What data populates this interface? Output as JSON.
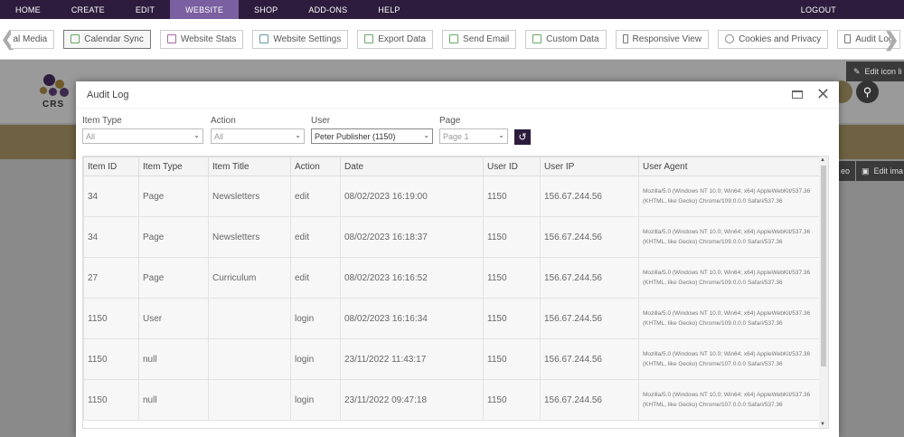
{
  "topnav": {
    "items": [
      "HOME",
      "CREATE",
      "EDIT",
      "WEBSITE",
      "SHOP",
      "ADD-ONS",
      "HELP"
    ],
    "active_index": 3,
    "logout": "LOGOUT"
  },
  "toolbar": {
    "buttons": [
      "al Media",
      "Calendar Sync",
      "Website Stats",
      "Website Settings",
      "Export Data",
      "Send Email",
      "Custom Data",
      "Responsive View",
      "Cookies and Privacy",
      "Audit Log"
    ],
    "selected_index": 1
  },
  "background": {
    "logo_text": "CRS",
    "edit_icon_label": "Edit icon li",
    "edit_image_label": "Edit ima",
    "side_label": "eo"
  },
  "modal": {
    "title": "Audit Log",
    "filters": [
      {
        "label": "Item Type",
        "value": "All"
      },
      {
        "label": "Action",
        "value": "All"
      },
      {
        "label": "User",
        "value": "Peter Publisher (1150)"
      },
      {
        "label": "Page",
        "value": "Page 1"
      }
    ],
    "columns": [
      "Item ID",
      "Item Type",
      "Item Title",
      "Action",
      "Date",
      "User ID",
      "User IP",
      "User Agent"
    ],
    "rows": [
      {
        "id": "34",
        "type": "Page",
        "title": "Newsletters",
        "action": "edit",
        "date": "08/02/2023 16:19:00",
        "uid": "1150",
        "ip": "156.67.244.56",
        "ua": "Mozilla/5.0 (Windows NT 10.0; Win64; x64) AppleWebKit/537.36 (KHTML, like Gecko) Chrome/109.0.0.0 Safari/537.36"
      },
      {
        "id": "34",
        "type": "Page",
        "title": "Newsletters",
        "action": "edit",
        "date": "08/02/2023 16:18:37",
        "uid": "1150",
        "ip": "156.67.244.56",
        "ua": "Mozilla/5.0 (Windows NT 10.0; Win64; x64) AppleWebKit/537.36 (KHTML, like Gecko) Chrome/109.0.0.0 Safari/537.36"
      },
      {
        "id": "27",
        "type": "Page",
        "title": "Curriculum",
        "action": "edit",
        "date": "08/02/2023 16:16:52",
        "uid": "1150",
        "ip": "156.67.244.56",
        "ua": "Mozilla/5.0 (Windows NT 10.0; Win64; x64) AppleWebKit/537.36 (KHTML, like Gecko) Chrome/109.0.0.0 Safari/537.36"
      },
      {
        "id": "1150",
        "type": "User",
        "title": "",
        "action": "login",
        "date": "08/02/2023 16:16:34",
        "uid": "1150",
        "ip": "156.67.244.56",
        "ua": "Mozilla/5.0 (Windows NT 10.0; Win64; x64) AppleWebKit/537.36 (KHTML, like Gecko) Chrome/109.0.0.0 Safari/537.36"
      },
      {
        "id": "1150",
        "type": "null",
        "title": "",
        "action": "login",
        "date": "23/11/2022 11:43:17",
        "uid": "1150",
        "ip": "156.67.244.56",
        "ua": "Mozilla/5.0 (Windows NT 10.0; Win64; x64) AppleWebKit/537.36 (KHTML, like Gecko) Chrome/107.0.0.0 Safari/537.36"
      },
      {
        "id": "1150",
        "type": "null",
        "title": "",
        "action": "login",
        "date": "23/11/2022 09:47:18",
        "uid": "1150",
        "ip": "156.67.244.56",
        "ua": "Mozilla/5.0 (Windows NT 10.0; Win64; x64) AppleWebKit/537.36 (KHTML, like Gecko) Chrome/107.0.0.0 Safari/537.36"
      }
    ]
  },
  "colors": {
    "nav_bg": "#2d1c3d",
    "nav_active": "#7a5fa1",
    "gold": "#6e6242"
  }
}
